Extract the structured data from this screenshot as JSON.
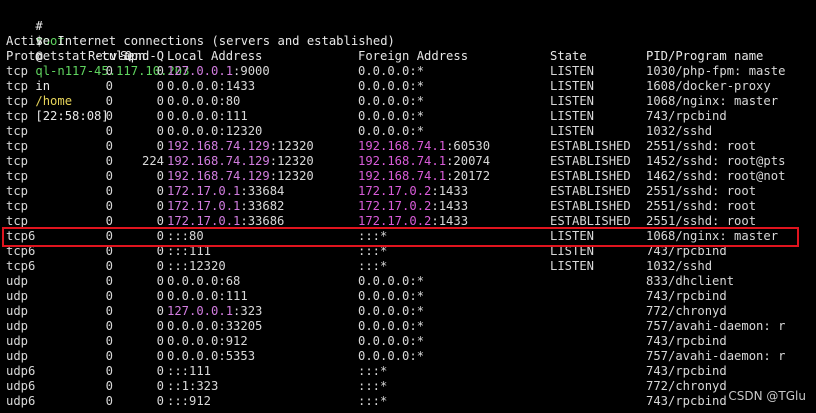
{
  "prompt": {
    "symbol": "#",
    "user": "root",
    "at": "@",
    "host": "ql-n117-45.117.10.203",
    "in": "in",
    "dir": "/home",
    "time": "[22:58:08]",
    "command_symbol": "$",
    "command": "netstat -tulapn"
  },
  "info": "Active Internet connections (servers and established)",
  "header": {
    "proto": "Proto",
    "recv": "Recv-Q",
    "send": "Send-Q",
    "local": "Local Address",
    "foreign": "Foreign Address",
    "state": "State",
    "pid": "PID/Program name"
  },
  "rows": [
    {
      "proto": "tcp",
      "recv": "0",
      "send": "0",
      "local_ip": "127.0.0.1",
      "local_port": ":9000",
      "local_plain": "",
      "foreign_ip": "",
      "foreign_port": "",
      "foreign_plain": "0.0.0.0:*",
      "state": "LISTEN",
      "pid": "1030/php-fpm: maste"
    },
    {
      "proto": "tcp",
      "recv": "0",
      "send": "0",
      "local_ip": "",
      "local_port": "",
      "local_plain": "0.0.0.0:1433",
      "foreign_ip": "",
      "foreign_port": "",
      "foreign_plain": "0.0.0.0:*",
      "state": "LISTEN",
      "pid": "1608/docker-proxy"
    },
    {
      "proto": "tcp",
      "recv": "0",
      "send": "0",
      "local_ip": "",
      "local_port": "",
      "local_plain": "0.0.0.0:80",
      "foreign_ip": "",
      "foreign_port": "",
      "foreign_plain": "0.0.0.0:*",
      "state": "LISTEN",
      "pid": "1068/nginx: master"
    },
    {
      "proto": "tcp",
      "recv": "0",
      "send": "0",
      "local_ip": "",
      "local_port": "",
      "local_plain": "0.0.0.0:111",
      "foreign_ip": "",
      "foreign_port": "",
      "foreign_plain": "0.0.0.0:*",
      "state": "LISTEN",
      "pid": "743/rpcbind"
    },
    {
      "proto": "tcp",
      "recv": "0",
      "send": "0",
      "local_ip": "",
      "local_port": "",
      "local_plain": "0.0.0.0:12320",
      "foreign_ip": "",
      "foreign_port": "",
      "foreign_plain": "0.0.0.0:*",
      "state": "LISTEN",
      "pid": "1032/sshd"
    },
    {
      "proto": "tcp",
      "recv": "0",
      "send": "0",
      "local_ip": "192.168.74.129",
      "local_port": ":12320",
      "local_plain": "",
      "foreign_ip": "192.168.74.1",
      "foreign_port": ":60530",
      "foreign_plain": "",
      "state": "ESTABLISHED",
      "pid": "2551/sshd: root"
    },
    {
      "proto": "tcp",
      "recv": "0",
      "send": "224",
      "local_ip": "192.168.74.129",
      "local_port": ":12320",
      "local_plain": "",
      "foreign_ip": "192.168.74.1",
      "foreign_port": ":20074",
      "foreign_plain": "",
      "state": "ESTABLISHED",
      "pid": "1452/sshd: root@pts"
    },
    {
      "proto": "tcp",
      "recv": "0",
      "send": "0",
      "local_ip": "192.168.74.129",
      "local_port": ":12320",
      "local_plain": "",
      "foreign_ip": "192.168.74.1",
      "foreign_port": ":20172",
      "foreign_plain": "",
      "state": "ESTABLISHED",
      "pid": "1462/sshd: root@not"
    },
    {
      "proto": "tcp",
      "recv": "0",
      "send": "0",
      "local_ip": "172.17.0.1",
      "local_port": ":33684",
      "local_plain": "",
      "foreign_ip": "172.17.0.2",
      "foreign_port": ":1433",
      "foreign_plain": "",
      "state": "ESTABLISHED",
      "pid": "2551/sshd: root"
    },
    {
      "proto": "tcp",
      "recv": "0",
      "send": "0",
      "local_ip": "172.17.0.1",
      "local_port": ":33682",
      "local_plain": "",
      "foreign_ip": "172.17.0.2",
      "foreign_port": ":1433",
      "foreign_plain": "",
      "state": "ESTABLISHED",
      "pid": "2551/sshd: root"
    },
    {
      "proto": "tcp",
      "recv": "0",
      "send": "0",
      "local_ip": "172.17.0.1",
      "local_port": ":33686",
      "local_plain": "",
      "foreign_ip": "172.17.0.2",
      "foreign_port": ":1433",
      "foreign_plain": "",
      "state": "ESTABLISHED",
      "pid": "2551/sshd: root"
    },
    {
      "proto": "tcp6",
      "recv": "0",
      "send": "0",
      "local_ip": "",
      "local_port": "",
      "local_plain": ":::80",
      "foreign_ip": "",
      "foreign_port": "",
      "foreign_plain": ":::*",
      "state": "LISTEN",
      "pid": "1068/nginx: master",
      "highlight": true
    },
    {
      "proto": "tcp6",
      "recv": "0",
      "send": "0",
      "local_ip": "",
      "local_port": "",
      "local_plain": ":::111",
      "foreign_ip": "",
      "foreign_port": "",
      "foreign_plain": ":::*",
      "state": "LISTEN",
      "pid": "743/rpcbind"
    },
    {
      "proto": "tcp6",
      "recv": "0",
      "send": "0",
      "local_ip": "",
      "local_port": "",
      "local_plain": ":::12320",
      "foreign_ip": "",
      "foreign_port": "",
      "foreign_plain": ":::*",
      "state": "LISTEN",
      "pid": "1032/sshd"
    },
    {
      "proto": "udp",
      "recv": "0",
      "send": "0",
      "local_ip": "",
      "local_port": "",
      "local_plain": "0.0.0.0:68",
      "foreign_ip": "",
      "foreign_port": "",
      "foreign_plain": "0.0.0.0:*",
      "state": "",
      "pid": "833/dhclient"
    },
    {
      "proto": "udp",
      "recv": "0",
      "send": "0",
      "local_ip": "",
      "local_port": "",
      "local_plain": "0.0.0.0:111",
      "foreign_ip": "",
      "foreign_port": "",
      "foreign_plain": "0.0.0.0:*",
      "state": "",
      "pid": "743/rpcbind"
    },
    {
      "proto": "udp",
      "recv": "0",
      "send": "0",
      "local_ip": "127.0.0.1",
      "local_port": ":323",
      "local_plain": "",
      "foreign_ip": "",
      "foreign_port": "",
      "foreign_plain": "0.0.0.0:*",
      "state": "",
      "pid": "772/chronyd"
    },
    {
      "proto": "udp",
      "recv": "0",
      "send": "0",
      "local_ip": "",
      "local_port": "",
      "local_plain": "0.0.0.0:33205",
      "foreign_ip": "",
      "foreign_port": "",
      "foreign_plain": "0.0.0.0:*",
      "state": "",
      "pid": "757/avahi-daemon: r"
    },
    {
      "proto": "udp",
      "recv": "0",
      "send": "0",
      "local_ip": "",
      "local_port": "",
      "local_plain": "0.0.0.0:912",
      "foreign_ip": "",
      "foreign_port": "",
      "foreign_plain": "0.0.0.0:*",
      "state": "",
      "pid": "743/rpcbind"
    },
    {
      "proto": "udp",
      "recv": "0",
      "send": "0",
      "local_ip": "",
      "local_port": "",
      "local_plain": "0.0.0.0:5353",
      "foreign_ip": "",
      "foreign_port": "",
      "foreign_plain": "0.0.0.0:*",
      "state": "",
      "pid": "757/avahi-daemon: r"
    },
    {
      "proto": "udp6",
      "recv": "0",
      "send": "0",
      "local_ip": "",
      "local_port": "",
      "local_plain": ":::111",
      "foreign_ip": "",
      "foreign_port": "",
      "foreign_plain": ":::*",
      "state": "",
      "pid": "743/rpcbind"
    },
    {
      "proto": "udp6",
      "recv": "0",
      "send": "0",
      "local_ip": "",
      "local_port": "",
      "local_plain": "::1:323",
      "foreign_ip": "",
      "foreign_port": "",
      "foreign_plain": ":::*",
      "state": "",
      "pid": "772/chronyd"
    },
    {
      "proto": "udp6",
      "recv": "0",
      "send": "0",
      "local_ip": "",
      "local_port": "",
      "local_plain": ":::912",
      "foreign_ip": "",
      "foreign_port": "",
      "foreign_plain": ":::*",
      "state": "",
      "pid": "743/rpcbind"
    }
  ],
  "watermark": "CSDN @TGlu",
  "colors": {
    "background": "#000000",
    "prompt_green": "#5fd45f",
    "prompt_yellow": "#e6d45a",
    "local_ip": "#d27de0",
    "foreign_ip": "#d95cd9",
    "highlight_box": "#e0141e"
  }
}
